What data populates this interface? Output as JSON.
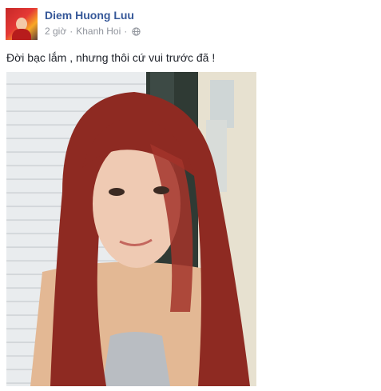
{
  "post": {
    "author": "Diem Huong Luu",
    "time": "2 giờ",
    "separator": "·",
    "location": "Khanh Hoi",
    "privacy_icon": "globe-icon",
    "caption": "Đời bạc lắm , nhưng thôi cứ vui trước đã !"
  },
  "colors": {
    "author_link": "#365899",
    "meta_text": "#90949c",
    "body_text": "#1d2129"
  }
}
